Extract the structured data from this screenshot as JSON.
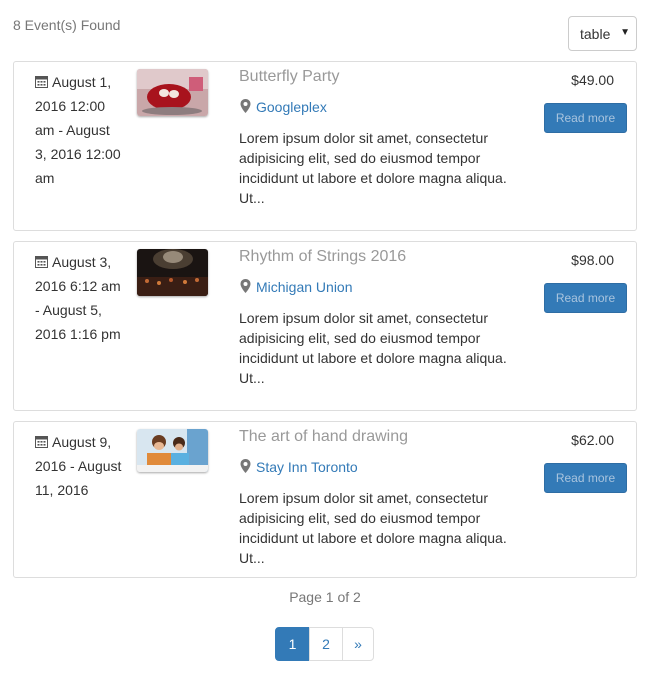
{
  "header": {
    "found_text": "8 Event(s) Found",
    "view_select": {
      "selected": "table",
      "caret": "▼"
    }
  },
  "events": [
    {
      "date_text": "August 1, 2016 12:00 am - August 3, 2016 12:00 am",
      "title": "Butterfly Party",
      "location": "Googleplex",
      "description": "Lorem ipsum dolor sit amet, consectetur adipisicing elit, sed do eiusmod tempor incididunt ut labore et dolore magna aliqua. Ut...",
      "price": "$49.00",
      "read_more": "Read more"
    },
    {
      "date_text": "August 3, 2016 6:12 am - August 5, 2016 1:16 pm",
      "title": "Rhythm of Strings 2016",
      "location": "Michigan Union",
      "description": "Lorem ipsum dolor sit amet, consectetur adipisicing elit, sed do eiusmod tempor incididunt ut labore et dolore magna aliqua. Ut...",
      "price": "$98.00",
      "read_more": "Read more"
    },
    {
      "date_text": "August 9, 2016 - August 11, 2016",
      "title": "The art of hand drawing",
      "location": "Stay Inn Toronto",
      "description": "Lorem ipsum dolor sit amet, consectetur adipisicing elit, sed do eiusmod tempor incididunt ut labore et dolore magna aliqua. Ut...",
      "price": "$62.00",
      "read_more": "Read more"
    }
  ],
  "pagination": {
    "page_info": "Page 1 of 2",
    "pages": [
      "1",
      "2",
      "»"
    ],
    "active_page": "1"
  },
  "colors": {
    "link": "#337ab7",
    "muted": "#999999",
    "button": "#337ab7"
  }
}
